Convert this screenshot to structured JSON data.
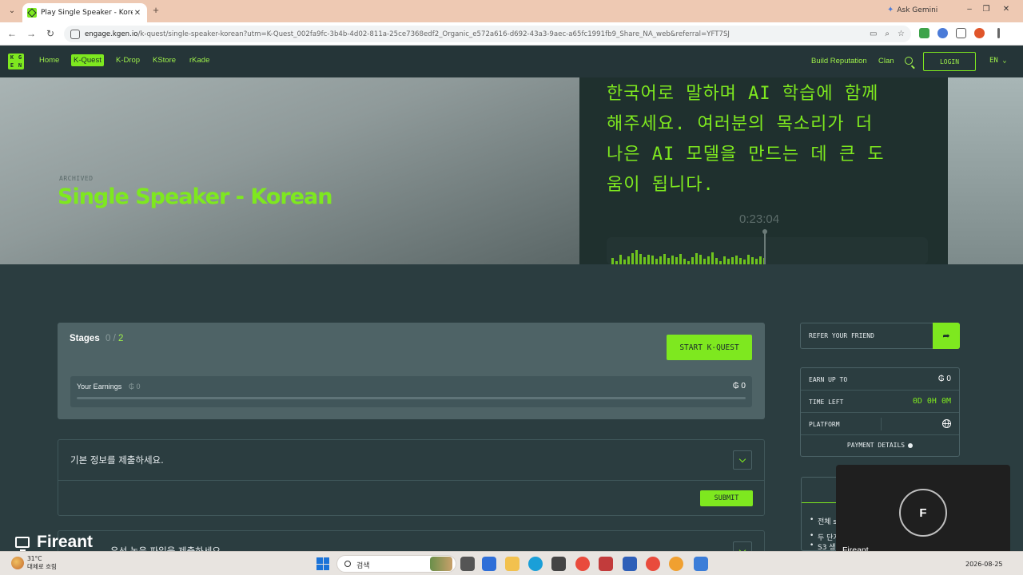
{
  "browser": {
    "tab_title": "Play Single Speaker - Korean, ...",
    "ask_gemini": "Ask Gemini",
    "url_host": "engage.kgen.io",
    "url_path": "/k-quest/single-speaker-korean?utm=K-Quest_002fa9fc-3b4b-4d02-811a-25ce7368edf2_Organic_e572a616-d692-43a3-9aec-a65fc1991fb9_Share_NA_web&referral=YFT7SJ"
  },
  "nav": {
    "logo_letters": [
      "K",
      "G",
      "E",
      "N"
    ],
    "links": [
      "Home",
      "K-Quest",
      "K-Drop",
      "KStore",
      "rKade"
    ],
    "active": "K-Quest",
    "build_reputation": "Build Reputation",
    "clan": "Clan",
    "login": "LOGIN",
    "lang": "EN ⌄"
  },
  "hero": {
    "status": "ARCHIVED",
    "title": "Single Speaker - Korean",
    "korean_lines": [
      "한국어로 말하며 AI 학습에 함께",
      "해주세요. 여러분의 목소리가 더",
      "나은 AI 모델을 만드는 데 큰 도",
      "움이 됩니다."
    ],
    "timer": "0:23:04",
    "wave_levels": [
      0.35,
      0.2,
      0.55,
      0.25,
      0.45,
      0.65,
      0.8,
      0.6,
      0.4,
      0.55,
      0.5,
      0.3,
      0.45,
      0.6,
      0.35,
      0.5,
      0.4,
      0.6,
      0.3,
      0.2,
      0.4,
      0.65,
      0.55,
      0.3,
      0.45,
      0.7,
      0.35,
      0.2,
      0.45,
      0.3,
      0.4,
      0.5,
      0.35,
      0.25,
      0.55,
      0.4,
      0.3,
      0.45,
      0.35,
      0.5
    ]
  },
  "stages": {
    "label": "Stages",
    "current": "0",
    "separator": "/",
    "total": "2",
    "start_button": "START K-QUEST",
    "earnings_label": "Your Earnings",
    "earnings_value": "₲ 0",
    "earnings_total": "₲ 0",
    "progress": 0
  },
  "sections": [
    {
      "title": "기본 정보를 제출하세요.",
      "submit": "SUBMIT"
    },
    {
      "title": "우선 녹음 파일을 제출하세요."
    }
  ],
  "side": {
    "refer_label": "REFER YOUR FRIEND",
    "earn_up_to_label": "EARN UP TO",
    "earn_up_to_value": "₲ 0",
    "time_left_label": "TIME LEFT",
    "time_left_value": "0D 0H 0M",
    "platform_label": "PLATFORM",
    "payment_details": "PAYMENT DETAILS",
    "rules": [
      "전체 s",
      "두 단계",
      "S3 생"
    ]
  },
  "call": {
    "avatar_letter": "F",
    "name": "Fireant"
  },
  "share": {
    "name": "Fireant"
  },
  "taskbar": {
    "temp": "31°C",
    "weather": "대체로 흐림",
    "search": "검색",
    "date": "2026-08-25"
  },
  "colors": {
    "accent": "#7ee81f",
    "background": "#2b3d40",
    "card": "#4e6366"
  }
}
